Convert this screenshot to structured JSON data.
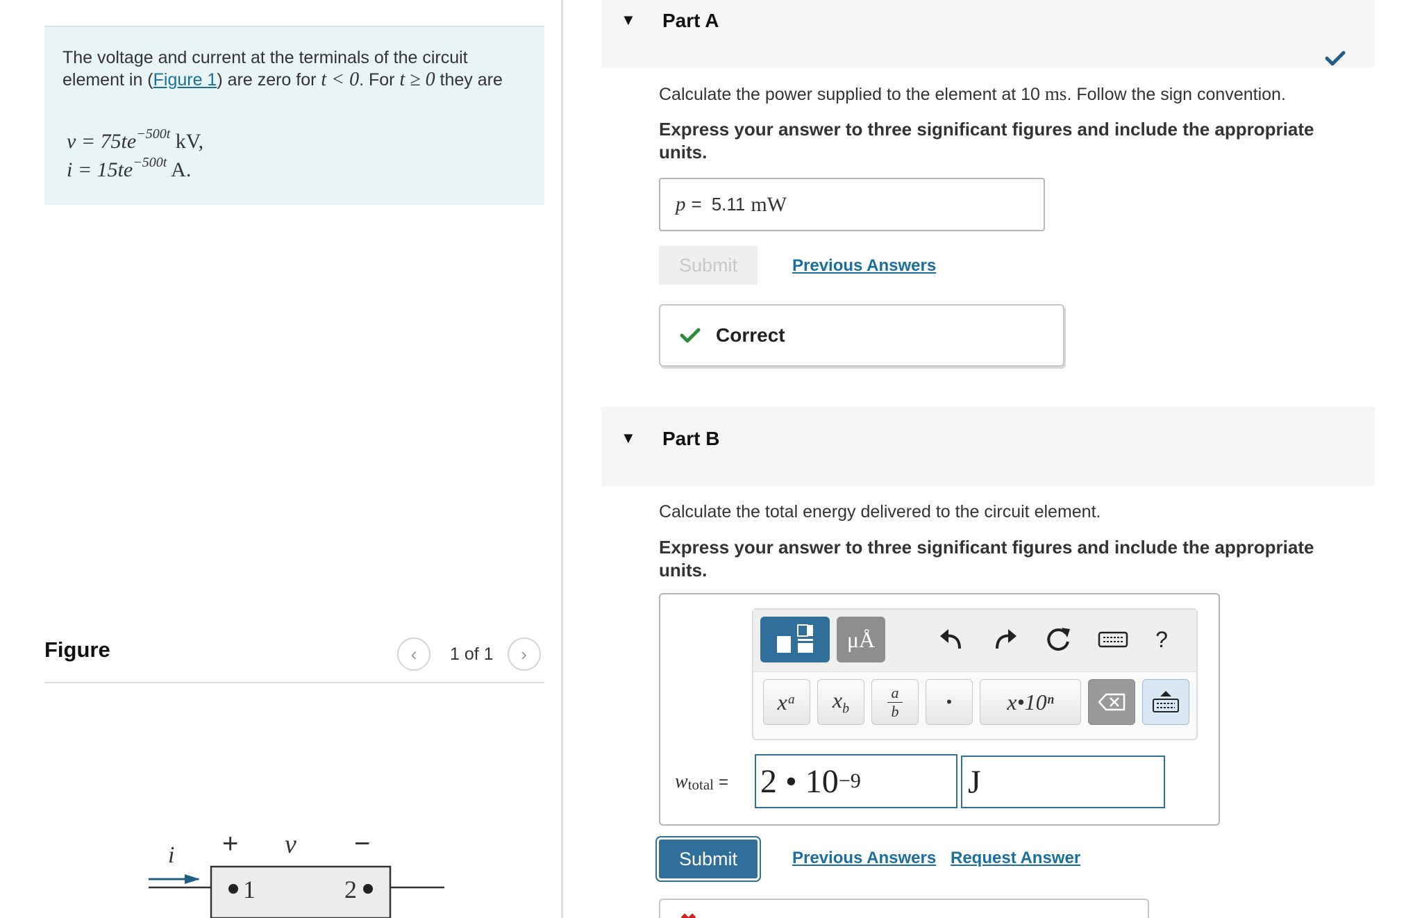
{
  "problem": {
    "text_before_link": "The voltage and current at the terminals of the circuit element in (",
    "link": "Figure 1",
    "text_after_link": ") are zero for ",
    "cond1": "t < 0",
    "mid": ". For ",
    "cond2": "t ≥ 0",
    "text_end": " they are",
    "eq_v_lhs": "v = 75te",
    "eq_v_exp": "−500t",
    "eq_v_unit": "kV,",
    "eq_i_lhs": "i = 15te",
    "eq_i_exp": "−500t",
    "eq_i_unit": "A."
  },
  "figure": {
    "title": "Figure",
    "counter": "1 of 1",
    "prev_icon": "chevron-left-icon",
    "next_icon": "chevron-right-icon",
    "labels": {
      "i": "i",
      "plus": "+",
      "v": "v",
      "minus": "−",
      "n1": "1",
      "n2": "2"
    }
  },
  "partA": {
    "label": "Part A",
    "question": "Calculate the power supplied to the element at 10 ms. Follow the sign convention.",
    "q_before_unit": "Calculate the power supplied to the element at 10 ",
    "q_unit": "ms",
    "q_after_unit": ". Follow the sign convention.",
    "instruction": "Express your answer to three significant figures and include the appropriate units.",
    "answer_var": "p",
    "answer_eq": "=",
    "answer_value": "5.11",
    "answer_unit": "mW",
    "submit_label": "Submit",
    "previous_answers": "Previous Answers",
    "feedback": "Correct",
    "status_icon": "check-icon"
  },
  "partB": {
    "label": "Part B",
    "question": "Calculate the total energy delivered to the circuit element.",
    "instruction": "Express your answer to three significant figures and include the appropriate units.",
    "var": "w",
    "var_sub": "total",
    "eq": "=",
    "input_value": "2 • 10",
    "input_exp": "−9",
    "unit_value": "J",
    "submit_label": "Submit",
    "previous_answers": "Previous Answers",
    "request_answer": "Request Answer",
    "toolbar": {
      "units_btn": "μÅ",
      "superscript": "xᵃ",
      "subscript": "x_b",
      "fraction_top": "a",
      "fraction_bottom": "b",
      "dot": "•",
      "sci": "x•10ⁿ",
      "help": "?"
    }
  },
  "colors": {
    "accent": "#2f6f9a",
    "link": "#1a6fa0",
    "success": "#2e8b3e",
    "error": "#cc2222",
    "problem_bg": "#e8f4f5"
  }
}
